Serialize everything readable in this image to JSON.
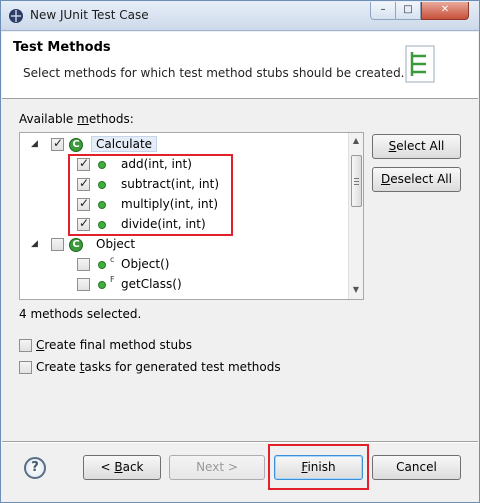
{
  "window": {
    "title": "New JUnit Test Case",
    "controls": {
      "minimize": "–",
      "maximize": "□",
      "close": "✕"
    }
  },
  "header": {
    "title": "Test Methods",
    "description": "Select methods for which test method stubs should be created."
  },
  "available_label_pre": "Available ",
  "available_label_u": "m",
  "available_label_post": "ethods:",
  "tree": {
    "class1": {
      "name": "Calculate",
      "checked": true,
      "icon_letter": "C"
    },
    "methods1": [
      {
        "label": "add(int, int)",
        "checked": true
      },
      {
        "label": "subtract(int, int)",
        "checked": true
      },
      {
        "label": "multiply(int, int)",
        "checked": true
      },
      {
        "label": "divide(int, int)",
        "checked": true
      }
    ],
    "class2": {
      "name": "Object",
      "checked": false,
      "icon_letter": "C"
    },
    "methods2": [
      {
        "label": "Object()",
        "modifier": "c",
        "checked": false
      },
      {
        "label": "getClass()",
        "modifier": "F",
        "checked": false
      }
    ]
  },
  "buttons": {
    "select_all_u": "S",
    "select_all_rest": "elect All",
    "deselect_all_u": "D",
    "deselect_all_rest": "eselect All",
    "back_pre": "< ",
    "back_u": "B",
    "back_rest": "ack",
    "next": "Next >",
    "finish_u": "F",
    "finish_rest": "inish",
    "cancel": "Cancel",
    "help": "?"
  },
  "status": "4 methods selected.",
  "options": {
    "final_u": "C",
    "final_rest": "reate final method stubs",
    "tasks_pre": "Create ",
    "tasks_u": "t",
    "tasks_rest": "asks for generated test methods"
  },
  "colors": {
    "highlight": "#e0202a",
    "class_icon": "#3c9a3c",
    "method_icon": "#3fae3f"
  }
}
